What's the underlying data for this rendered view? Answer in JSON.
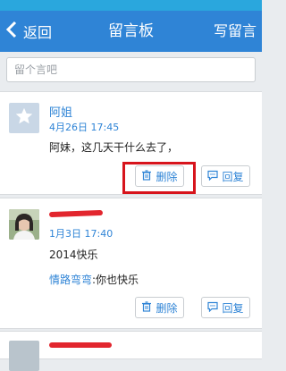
{
  "header": {
    "back_label": "返回",
    "title": "留言板",
    "write_label": "写留言"
  },
  "search": {
    "placeholder": "留个言吧"
  },
  "messages": [
    {
      "name": "阿姐",
      "time": "4月26日 17:45",
      "text": "阿妹，这几天干什么去了，",
      "delete_label": "删除",
      "reply_label": "回复"
    },
    {
      "time": "1月3日 17:40",
      "text": "2014快乐",
      "reply_user": "情路弯弯",
      "reply_text": ":你也快乐",
      "delete_label": "删除",
      "reply_label": "回复"
    }
  ],
  "colors": {
    "accent": "#2f84d6",
    "highlight": "#d7141c",
    "redaction": "#e2262e"
  }
}
